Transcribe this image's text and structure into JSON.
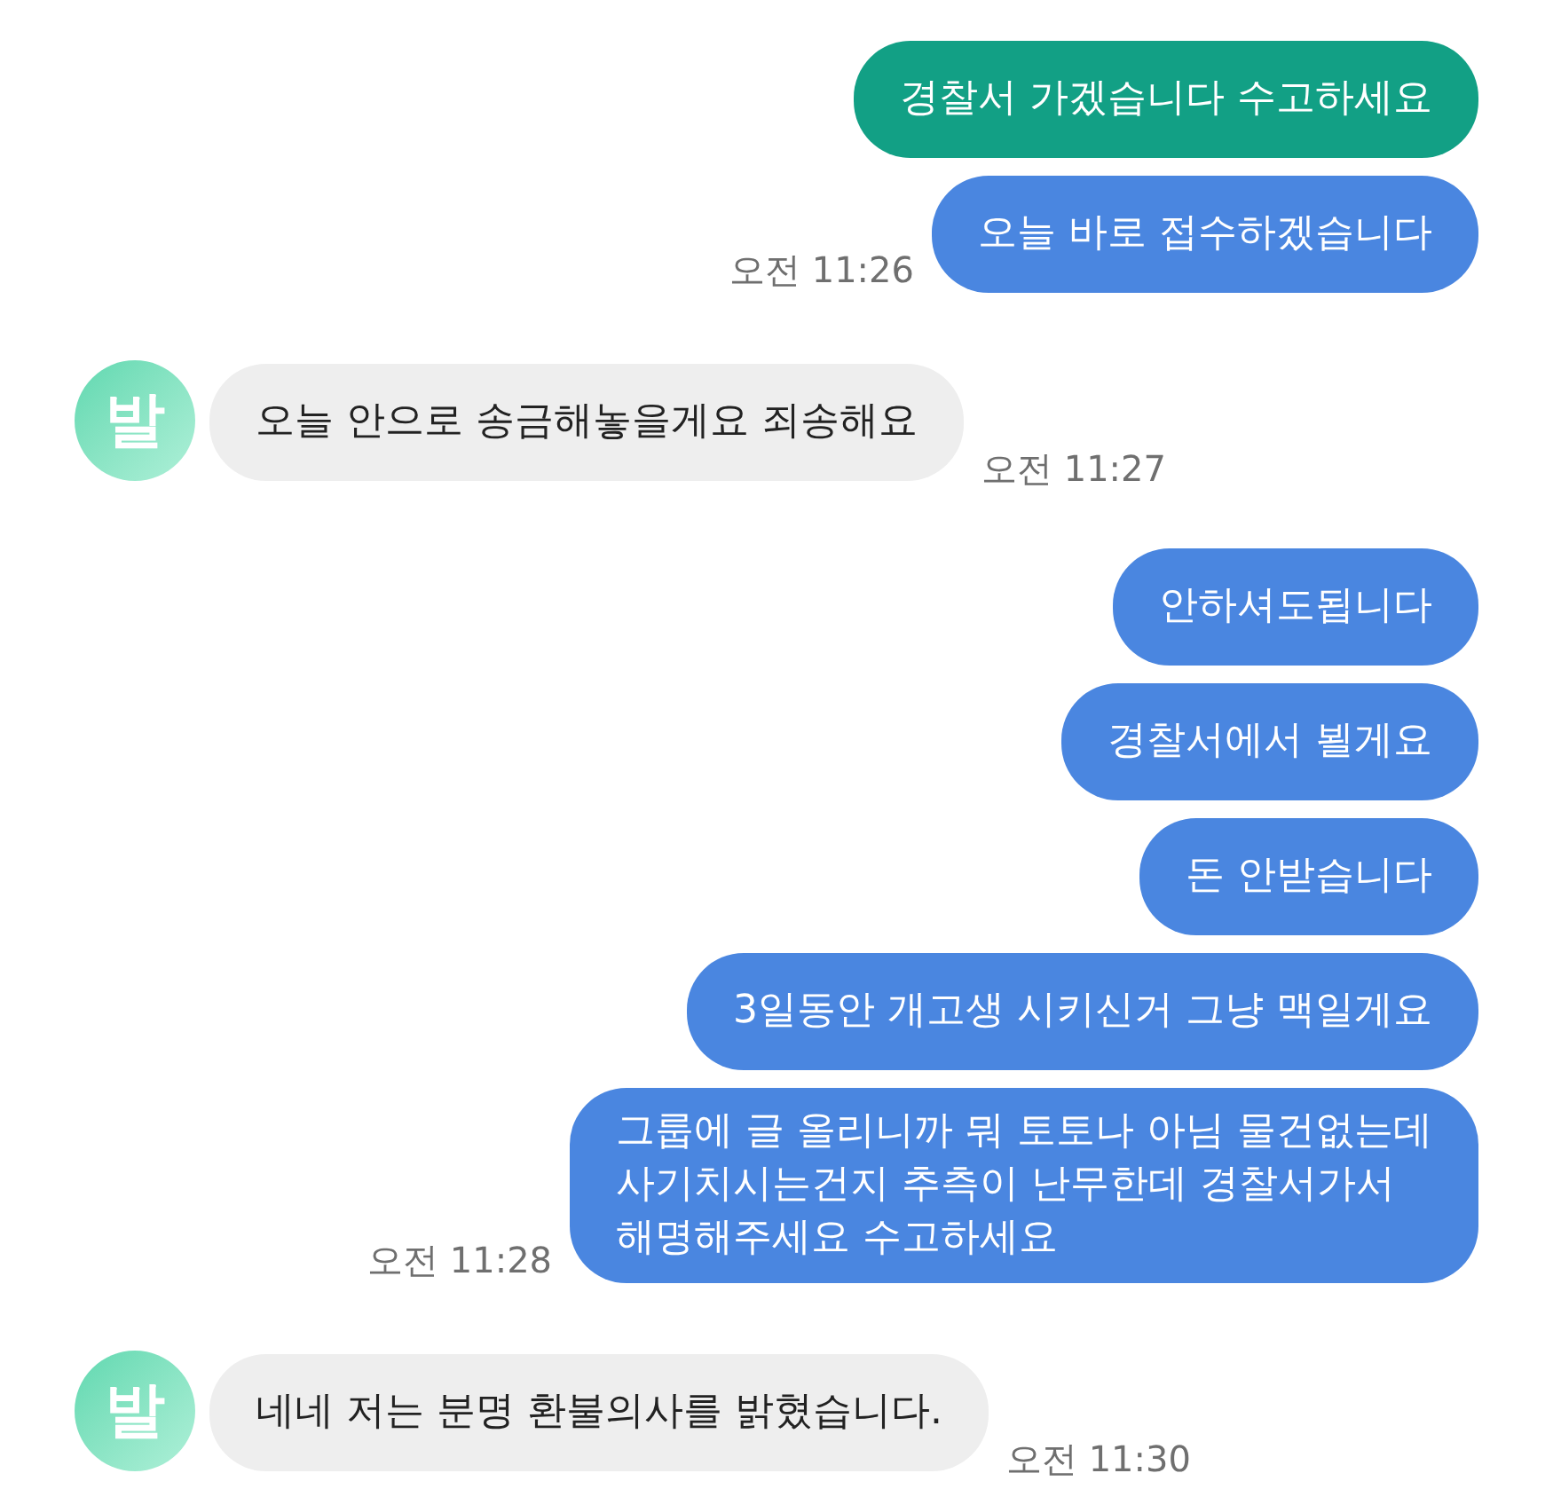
{
  "messages": [
    {
      "kind": "sent",
      "text": "경찰서 가겠습니다 수고하세요",
      "color": "#12a085"
    },
    {
      "kind": "sent",
      "text": "오늘 바로 접수하겠습니다",
      "color": "#4a86e0",
      "time": "오전 11:26"
    },
    {
      "kind": "received",
      "avatar": "발",
      "text": "오늘 안으로 송금해놓을게요 죄송해요",
      "time": "오전 11:27"
    },
    {
      "kind": "sent",
      "text": "안하셔도됩니다",
      "color": "#4a86e0"
    },
    {
      "kind": "sent",
      "text": "경찰서에서 뵐게요",
      "color": "#4a86e0"
    },
    {
      "kind": "sent",
      "text": "돈 안받습니다",
      "color": "#4a86e0"
    },
    {
      "kind": "sent",
      "text": "3일동안 개고생 시키신거 그냥 맥일게요",
      "color": "#4a86e0"
    },
    {
      "kind": "sent",
      "text": "그룹에 글 올리니까 뭐 토토나 아님 물건없는데\n사기치시는건지 추측이 난무한데 경찰서가서\n해명해주세요 수고하세요",
      "color": "#4a86e0",
      "time": "오전 11:28"
    },
    {
      "kind": "received",
      "avatar": "발",
      "text": "네네 저는 분명 환불의사를 밝혔습니다.",
      "time": "오전 11:30"
    }
  ]
}
